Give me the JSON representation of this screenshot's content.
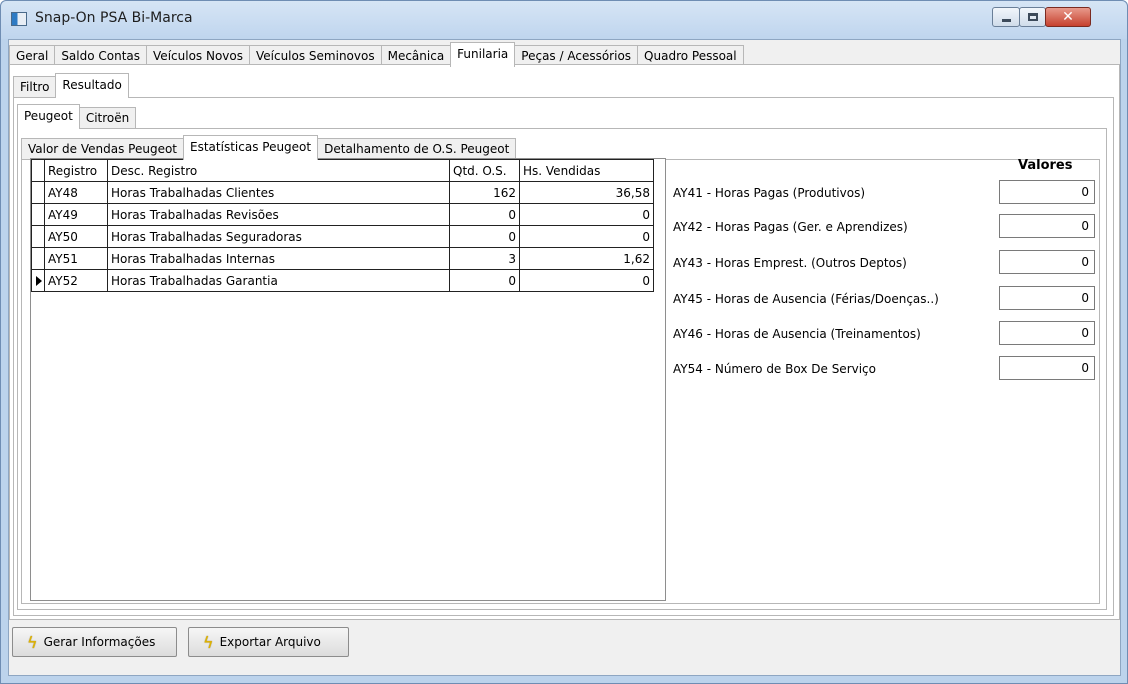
{
  "window": {
    "title": "Snap-On PSA Bi-Marca"
  },
  "main_tabs": [
    "Geral",
    "Saldo Contas",
    "Veículos Novos",
    "Veículos Seminovos",
    "Mecânica",
    "Funilaria",
    "Peças / Acessórios",
    "Quadro Pessoal"
  ],
  "main_tab_active": "Funilaria",
  "sub_tabs": [
    "Filtro",
    "Resultado"
  ],
  "brand_tabs": [
    "Peugeot",
    "Citroën"
  ],
  "report_tabs": [
    "Valor de Vendas Peugeot",
    "Estatísticas Peugeot",
    "Detalhamento de O.S. Peugeot"
  ],
  "grid": {
    "columns": [
      "Registro",
      "Desc. Registro",
      "Qtd. O.S.",
      "Hs. Vendidas"
    ],
    "rows": [
      [
        "AY48",
        "Horas Trabalhadas Clientes",
        "162",
        "36,58"
      ],
      [
        "AY49",
        "Horas Trabalhadas Revisões",
        "0",
        "0"
      ],
      [
        "AY50",
        "Horas Trabalhadas Seguradoras",
        "0",
        "0"
      ],
      [
        "AY51",
        "Horas Trabalhadas Internas",
        "3",
        "1,62"
      ],
      [
        "AY52",
        "Horas Trabalhadas Garantia",
        "0",
        "0"
      ]
    ]
  },
  "valores": {
    "header": "Valores",
    "fields": [
      {
        "label": "AY41 - Horas Pagas (Produtivos)",
        "value": "0"
      },
      {
        "label": "AY42 - Horas Pagas (Ger. e Aprendizes)",
        "value": "0"
      },
      {
        "label": "AY43 - Horas Emprest. (Outros Deptos)",
        "value": "0"
      },
      {
        "label": "AY45 - Horas de Ausencia (Férias/Doenças..)",
        "value": "0"
      },
      {
        "label": "AY46 - Horas de Ausencia (Treinamentos)",
        "value": "0"
      },
      {
        "label": "AY54 - Número de Box De Serviço",
        "value": "0"
      }
    ]
  },
  "actions": {
    "gerar_label": "Gerar Informações",
    "exportar_label": "Exportar Arquivo"
  }
}
